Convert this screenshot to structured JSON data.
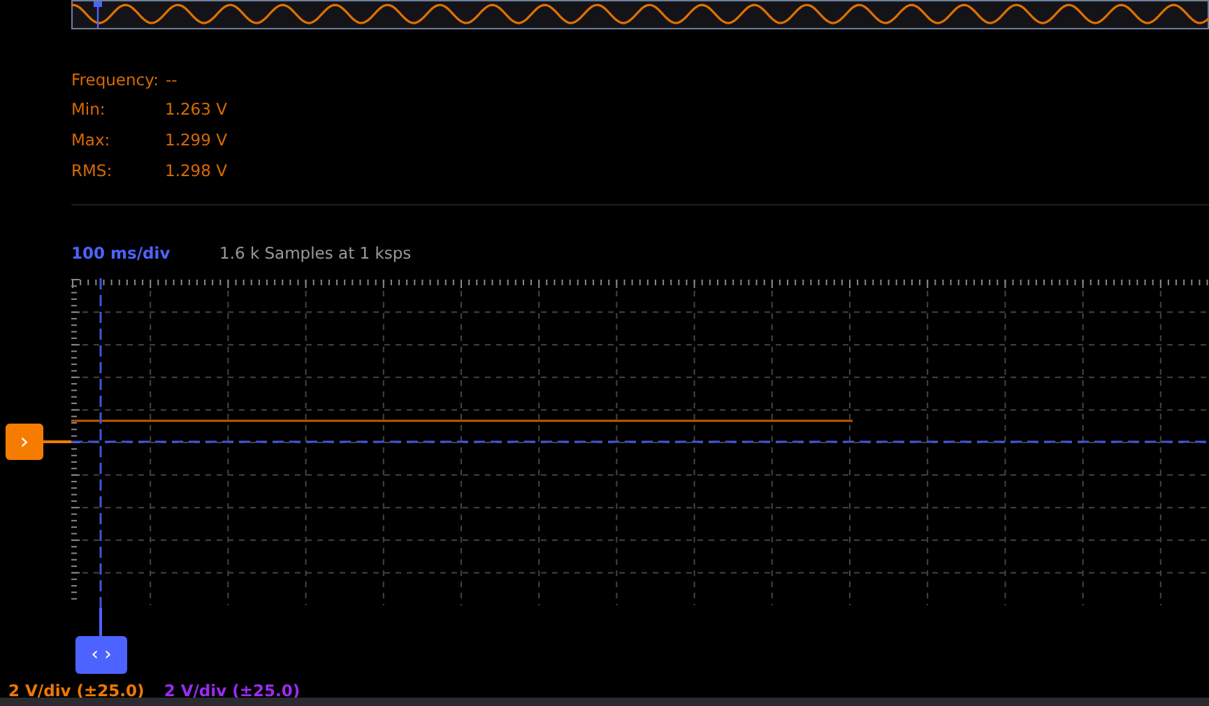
{
  "measurements": [
    {
      "label": "Frequency:",
      "value": "--",
      "kind": "inline"
    },
    {
      "label": "Min:",
      "value": "1.263 V",
      "kind": "column"
    },
    {
      "label": "Max:",
      "value": "1.299 V",
      "kind": "column"
    },
    {
      "label": "RMS:",
      "value": "1.298 V",
      "kind": "column"
    }
  ],
  "timebase": {
    "scale": "100 ms/div",
    "samples": "1.6 k Samples at 1 ksps"
  },
  "handles": {
    "channel": "›",
    "time": "‹ ›"
  },
  "channels": [
    {
      "scale": "2 V/div (±25.0)",
      "color": "#f07800"
    },
    {
      "scale": "2 V/div (±25.0)",
      "color": "#9a2cf0"
    }
  ]
}
